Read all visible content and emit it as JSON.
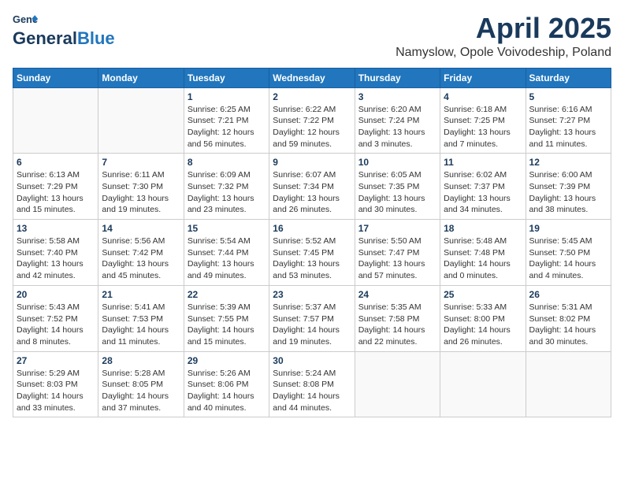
{
  "header": {
    "logo_line1": "General",
    "logo_line2": "Blue",
    "month": "April 2025",
    "location": "Namyslow, Opole Voivodeship, Poland"
  },
  "weekdays": [
    "Sunday",
    "Monday",
    "Tuesday",
    "Wednesday",
    "Thursday",
    "Friday",
    "Saturday"
  ],
  "weeks": [
    [
      {
        "day": "",
        "detail": ""
      },
      {
        "day": "",
        "detail": ""
      },
      {
        "day": "1",
        "detail": "Sunrise: 6:25 AM\nSunset: 7:21 PM\nDaylight: 12 hours\nand 56 minutes."
      },
      {
        "day": "2",
        "detail": "Sunrise: 6:22 AM\nSunset: 7:22 PM\nDaylight: 12 hours\nand 59 minutes."
      },
      {
        "day": "3",
        "detail": "Sunrise: 6:20 AM\nSunset: 7:24 PM\nDaylight: 13 hours\nand 3 minutes."
      },
      {
        "day": "4",
        "detail": "Sunrise: 6:18 AM\nSunset: 7:25 PM\nDaylight: 13 hours\nand 7 minutes."
      },
      {
        "day": "5",
        "detail": "Sunrise: 6:16 AM\nSunset: 7:27 PM\nDaylight: 13 hours\nand 11 minutes."
      }
    ],
    [
      {
        "day": "6",
        "detail": "Sunrise: 6:13 AM\nSunset: 7:29 PM\nDaylight: 13 hours\nand 15 minutes."
      },
      {
        "day": "7",
        "detail": "Sunrise: 6:11 AM\nSunset: 7:30 PM\nDaylight: 13 hours\nand 19 minutes."
      },
      {
        "day": "8",
        "detail": "Sunrise: 6:09 AM\nSunset: 7:32 PM\nDaylight: 13 hours\nand 23 minutes."
      },
      {
        "day": "9",
        "detail": "Sunrise: 6:07 AM\nSunset: 7:34 PM\nDaylight: 13 hours\nand 26 minutes."
      },
      {
        "day": "10",
        "detail": "Sunrise: 6:05 AM\nSunset: 7:35 PM\nDaylight: 13 hours\nand 30 minutes."
      },
      {
        "day": "11",
        "detail": "Sunrise: 6:02 AM\nSunset: 7:37 PM\nDaylight: 13 hours\nand 34 minutes."
      },
      {
        "day": "12",
        "detail": "Sunrise: 6:00 AM\nSunset: 7:39 PM\nDaylight: 13 hours\nand 38 minutes."
      }
    ],
    [
      {
        "day": "13",
        "detail": "Sunrise: 5:58 AM\nSunset: 7:40 PM\nDaylight: 13 hours\nand 42 minutes."
      },
      {
        "day": "14",
        "detail": "Sunrise: 5:56 AM\nSunset: 7:42 PM\nDaylight: 13 hours\nand 45 minutes."
      },
      {
        "day": "15",
        "detail": "Sunrise: 5:54 AM\nSunset: 7:44 PM\nDaylight: 13 hours\nand 49 minutes."
      },
      {
        "day": "16",
        "detail": "Sunrise: 5:52 AM\nSunset: 7:45 PM\nDaylight: 13 hours\nand 53 minutes."
      },
      {
        "day": "17",
        "detail": "Sunrise: 5:50 AM\nSunset: 7:47 PM\nDaylight: 13 hours\nand 57 minutes."
      },
      {
        "day": "18",
        "detail": "Sunrise: 5:48 AM\nSunset: 7:48 PM\nDaylight: 14 hours\nand 0 minutes."
      },
      {
        "day": "19",
        "detail": "Sunrise: 5:45 AM\nSunset: 7:50 PM\nDaylight: 14 hours\nand 4 minutes."
      }
    ],
    [
      {
        "day": "20",
        "detail": "Sunrise: 5:43 AM\nSunset: 7:52 PM\nDaylight: 14 hours\nand 8 minutes."
      },
      {
        "day": "21",
        "detail": "Sunrise: 5:41 AM\nSunset: 7:53 PM\nDaylight: 14 hours\nand 11 minutes."
      },
      {
        "day": "22",
        "detail": "Sunrise: 5:39 AM\nSunset: 7:55 PM\nDaylight: 14 hours\nand 15 minutes."
      },
      {
        "day": "23",
        "detail": "Sunrise: 5:37 AM\nSunset: 7:57 PM\nDaylight: 14 hours\nand 19 minutes."
      },
      {
        "day": "24",
        "detail": "Sunrise: 5:35 AM\nSunset: 7:58 PM\nDaylight: 14 hours\nand 22 minutes."
      },
      {
        "day": "25",
        "detail": "Sunrise: 5:33 AM\nSunset: 8:00 PM\nDaylight: 14 hours\nand 26 minutes."
      },
      {
        "day": "26",
        "detail": "Sunrise: 5:31 AM\nSunset: 8:02 PM\nDaylight: 14 hours\nand 30 minutes."
      }
    ],
    [
      {
        "day": "27",
        "detail": "Sunrise: 5:29 AM\nSunset: 8:03 PM\nDaylight: 14 hours\nand 33 minutes."
      },
      {
        "day": "28",
        "detail": "Sunrise: 5:28 AM\nSunset: 8:05 PM\nDaylight: 14 hours\nand 37 minutes."
      },
      {
        "day": "29",
        "detail": "Sunrise: 5:26 AM\nSunset: 8:06 PM\nDaylight: 14 hours\nand 40 minutes."
      },
      {
        "day": "30",
        "detail": "Sunrise: 5:24 AM\nSunset: 8:08 PM\nDaylight: 14 hours\nand 44 minutes."
      },
      {
        "day": "",
        "detail": ""
      },
      {
        "day": "",
        "detail": ""
      },
      {
        "day": "",
        "detail": ""
      }
    ]
  ]
}
